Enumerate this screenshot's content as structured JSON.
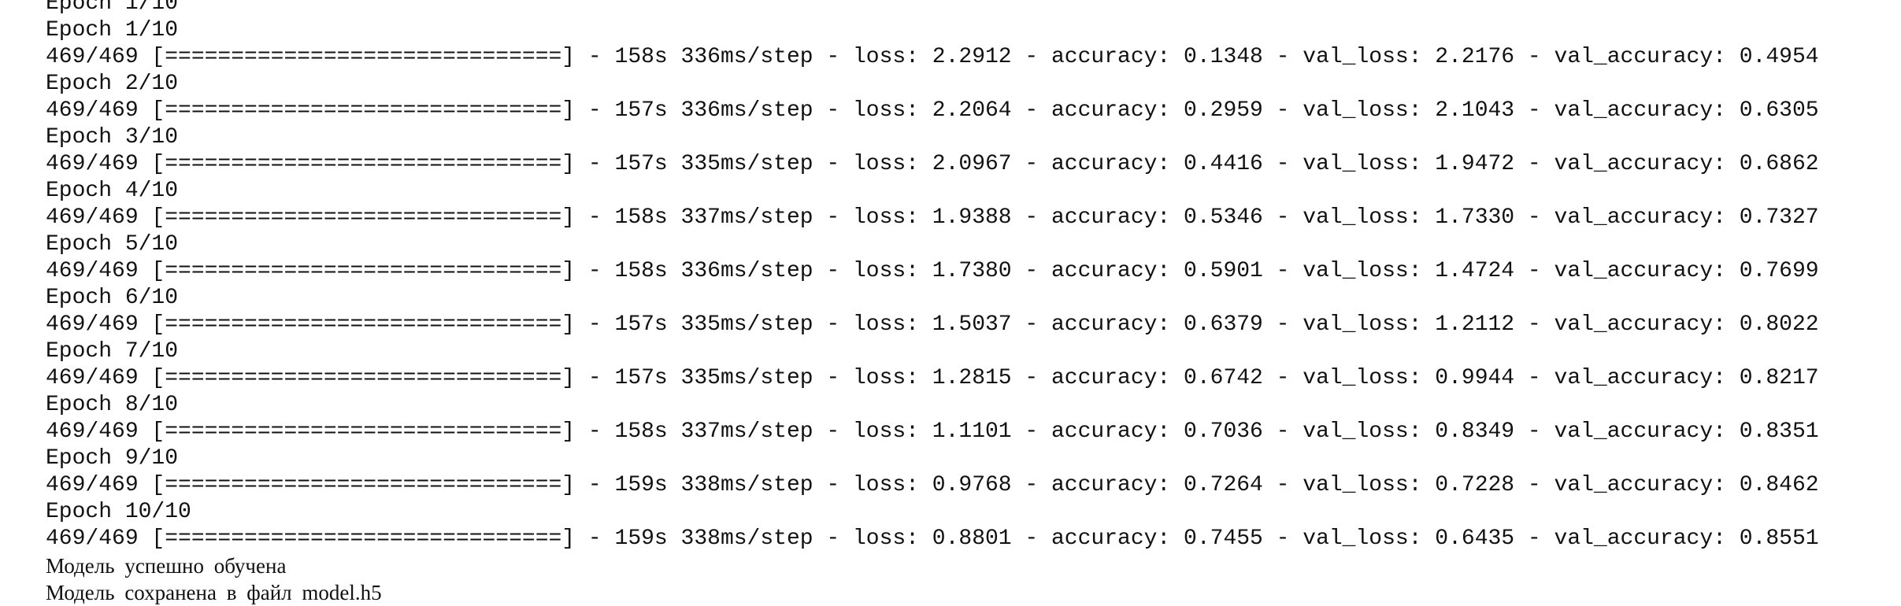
{
  "output": {
    "top_fragment": "Epoch 1/10",
    "epochs": [
      {
        "header": "Epoch 1/10",
        "progress": "469/469 [==============================] - 158s 336ms/step - loss: 2.2912 - accuracy: 0.1348 - val_loss: 2.2176 - val_accuracy: 0.4954"
      },
      {
        "header": "Epoch 2/10",
        "progress": "469/469 [==============================] - 157s 336ms/step - loss: 2.2064 - accuracy: 0.2959 - val_loss: 2.1043 - val_accuracy: 0.6305"
      },
      {
        "header": "Epoch 3/10",
        "progress": "469/469 [==============================] - 157s 335ms/step - loss: 2.0967 - accuracy: 0.4416 - val_loss: 1.9472 - val_accuracy: 0.6862"
      },
      {
        "header": "Epoch 4/10",
        "progress": "469/469 [==============================] - 158s 337ms/step - loss: 1.9388 - accuracy: 0.5346 - val_loss: 1.7330 - val_accuracy: 0.7327"
      },
      {
        "header": "Epoch 5/10",
        "progress": "469/469 [==============================] - 158s 336ms/step - loss: 1.7380 - accuracy: 0.5901 - val_loss: 1.4724 - val_accuracy: 0.7699"
      },
      {
        "header": "Epoch 6/10",
        "progress": "469/469 [==============================] - 157s 335ms/step - loss: 1.5037 - accuracy: 0.6379 - val_loss: 1.2112 - val_accuracy: 0.8022"
      },
      {
        "header": "Epoch 7/10",
        "progress": "469/469 [==============================] - 157s 335ms/step - loss: 1.2815 - accuracy: 0.6742 - val_loss: 0.9944 - val_accuracy: 0.8217"
      },
      {
        "header": "Epoch 8/10",
        "progress": "469/469 [==============================] - 158s 337ms/step - loss: 1.1101 - accuracy: 0.7036 - val_loss: 0.8349 - val_accuracy: 0.8351"
      },
      {
        "header": "Epoch 9/10",
        "progress": "469/469 [==============================] - 159s 338ms/step - loss: 0.9768 - accuracy: 0.7264 - val_loss: 0.7228 - val_accuracy: 0.8462"
      },
      {
        "header": "Epoch 10/10",
        "progress": "469/469 [==============================] - 159s 338ms/step - loss: 0.8801 - accuracy: 0.7455 - val_loss: 0.6435 - val_accuracy: 0.8551"
      }
    ],
    "success_message": "Модель успешно обучена",
    "bottom_fragment": "Модель сохранена в файл model.h5"
  },
  "colors": {
    "background": "#ffffff",
    "text": "#111111"
  }
}
